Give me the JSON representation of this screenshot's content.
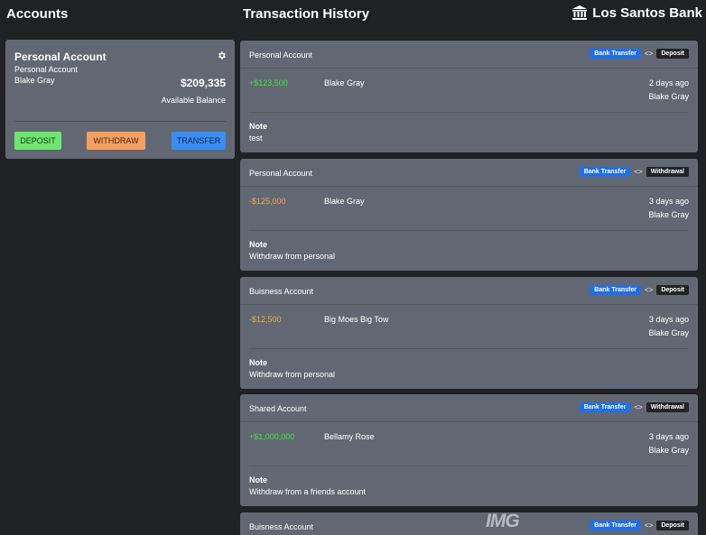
{
  "header": {
    "accounts_title": "Accounts",
    "history_title": "Transaction History",
    "bank_name": "Los Santos Bank"
  },
  "account_card": {
    "title": "Personal Account",
    "subtitle": "Personal Account",
    "owner": "Blake Gray",
    "balance": "$209,335",
    "balance_label": "Available Balance",
    "buttons": {
      "deposit": "DEPOSIT",
      "withdraw": "WITHDRAW",
      "transfer": "TRANSFER"
    }
  },
  "transactions": [
    {
      "account": "Personal Account",
      "method": "Bank Transfer",
      "separator": "<>",
      "type": "Deposit",
      "amount": "+$123,500",
      "party": "Blake Gray",
      "when": "2 days ago",
      "by": "Blake Gray",
      "note_label": "Note",
      "note": "test"
    },
    {
      "account": "Personal Account",
      "method": "Bank Transfer",
      "separator": "<>",
      "type": "Withdrawal",
      "amount": "-$125,000",
      "party": "Blake Gray",
      "when": "3 days ago",
      "by": "Blake Gray",
      "note_label": "Note",
      "note": "Withdraw from personal"
    },
    {
      "account": "Buisness Account",
      "method": "Bank Transfer",
      "separator": "<>",
      "type": "Deposit",
      "amount": "-$12,500",
      "party": "Big Moes Big Tow",
      "when": "3 days ago",
      "by": "Blake Gray",
      "note_label": "Note",
      "note": "Withdraw from personal"
    },
    {
      "account": "Shared Account",
      "method": "Bank Transfer",
      "separator": "<>",
      "type": "Withdrawal",
      "amount": "+$1,000,000",
      "party": "Bellamy Rose",
      "when": "3 days ago",
      "by": "Blake Gray",
      "note_label": "Note",
      "note": "Withdraw from a friends account"
    },
    {
      "account": "Buisness Account",
      "method": "Bank Transfer",
      "separator": "<>",
      "type": "Deposit"
    }
  ],
  "watermark": "IMG",
  "icons": {
    "bank": "bank-icon",
    "settings": "gear-icon"
  },
  "colors": {
    "positive": "#3ee03e",
    "negative": "#f4a742",
    "deposit_button": "#6ee670",
    "withdraw_button": "#f4a063",
    "transfer_button": "#3a8df2",
    "method_tag": "#1f6feb"
  }
}
